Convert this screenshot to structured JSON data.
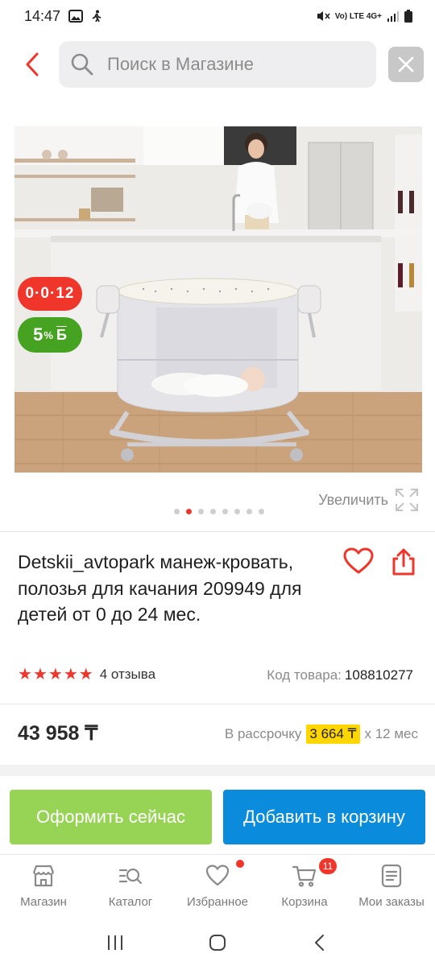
{
  "status_bar": {
    "time": "14:47",
    "network": "Vo) LTE 4G+"
  },
  "search": {
    "placeholder": "Поиск в Магазине"
  },
  "product": {
    "badge_installment": "0·0·12",
    "badge_bonus_value": "5",
    "badge_bonus_unit": "%",
    "badge_bonus_currency": "Б",
    "zoom_label": "Увеличить",
    "gallery_count": 8,
    "gallery_active_index": 1,
    "title": "Detskii_avtopark манеж-кровать, полозья для качания 209949 для детей от 0 до 24 мес.",
    "rating_stars": 5,
    "reviews": "4 отзыва",
    "sku_label": "Код товара:",
    "sku_value": "108810277",
    "price": "43 958 ₸",
    "installment_prefix": "В рассрочку",
    "installment_amount": "3 664 ₸",
    "installment_suffix": "x 12 мес"
  },
  "actions": {
    "buy_now": "Оформить сейчас",
    "add_to_cart": "Добавить в корзину"
  },
  "tabbar": {
    "items": [
      {
        "label": "Магазин",
        "icon": "store-icon"
      },
      {
        "label": "Каталог",
        "icon": "catalog-search-icon"
      },
      {
        "label": "Избранное",
        "icon": "heart-icon"
      },
      {
        "label": "Корзина",
        "icon": "cart-icon"
      },
      {
        "label": "Мои заказы",
        "icon": "orders-icon"
      }
    ],
    "cart_count": "11"
  },
  "colors": {
    "accent_red": "#f0352a",
    "buy_green": "#97d455",
    "cart_blue": "#0a8bdc",
    "bonus_green": "#45a321",
    "installment_yellow": "#ffd600"
  }
}
